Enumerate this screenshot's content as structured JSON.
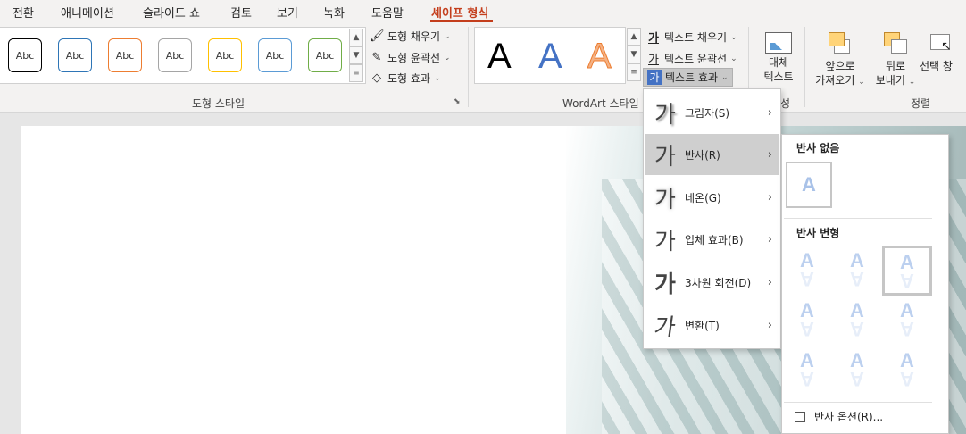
{
  "tabs": [
    {
      "label": "전환",
      "active": false
    },
    {
      "label": "애니메이션",
      "active": false
    },
    {
      "label": "슬라이드 쇼",
      "active": false
    },
    {
      "label": "검토",
      "active": false
    },
    {
      "label": "보기",
      "active": false
    },
    {
      "label": "녹화",
      "active": false
    },
    {
      "label": "도움말",
      "active": false
    },
    {
      "label": "셰이프 형식",
      "active": true
    }
  ],
  "shape_styles": {
    "group_label": "도형 스타일",
    "thumb_text": "Abc",
    "thumb_colors": [
      "#000000",
      "#2e75b6",
      "#ed7d31",
      "#a5a5a5",
      "#ffc000",
      "#5b9bd5",
      "#70ad47"
    ],
    "fill": "도형 채우기",
    "outline": "도형 윤곽선",
    "effect": "도형 효과"
  },
  "wordart": {
    "group_label": "WordArt 스타일",
    "letters": [
      {
        "char": "A",
        "color": "#000000"
      },
      {
        "char": "A",
        "color": "#4472c4"
      },
      {
        "char": "A",
        "color": "#f4b183"
      }
    ],
    "text_fill": "텍스트 채우기",
    "text_outline": "텍스트 윤곽선",
    "text_effect": "텍스트 효과"
  },
  "alt_text": {
    "line1": "대체",
    "line2": "텍스트"
  },
  "accessibility_fragment": "성",
  "arrange": {
    "group_label": "정렬",
    "bring_forward": {
      "line1": "앞으로",
      "line2": "가져오기"
    },
    "send_backward": {
      "line1": "뒤로",
      "line2": "보내기"
    },
    "selection_pane": "선택 창"
  },
  "text_effect_menu": [
    {
      "glyph": "가",
      "label": "그림자(S)",
      "highlighted": false
    },
    {
      "glyph": "가",
      "label": "반사(R)",
      "highlighted": true
    },
    {
      "glyph": "가",
      "label": "네온(G)",
      "highlighted": false
    },
    {
      "glyph": "가",
      "label": "입체 효과(B)",
      "highlighted": false
    },
    {
      "glyph": "가",
      "label": "3차원 회전(D)",
      "highlighted": false
    },
    {
      "glyph": "가",
      "label": "변환(T)",
      "highlighted": false
    }
  ],
  "reflection_submenu": {
    "no_reflection_header": "반사 없음",
    "variations_header": "반사 변형",
    "sample_char": "A",
    "options_label": "반사 옵션(R)...",
    "selected_index": 2
  }
}
